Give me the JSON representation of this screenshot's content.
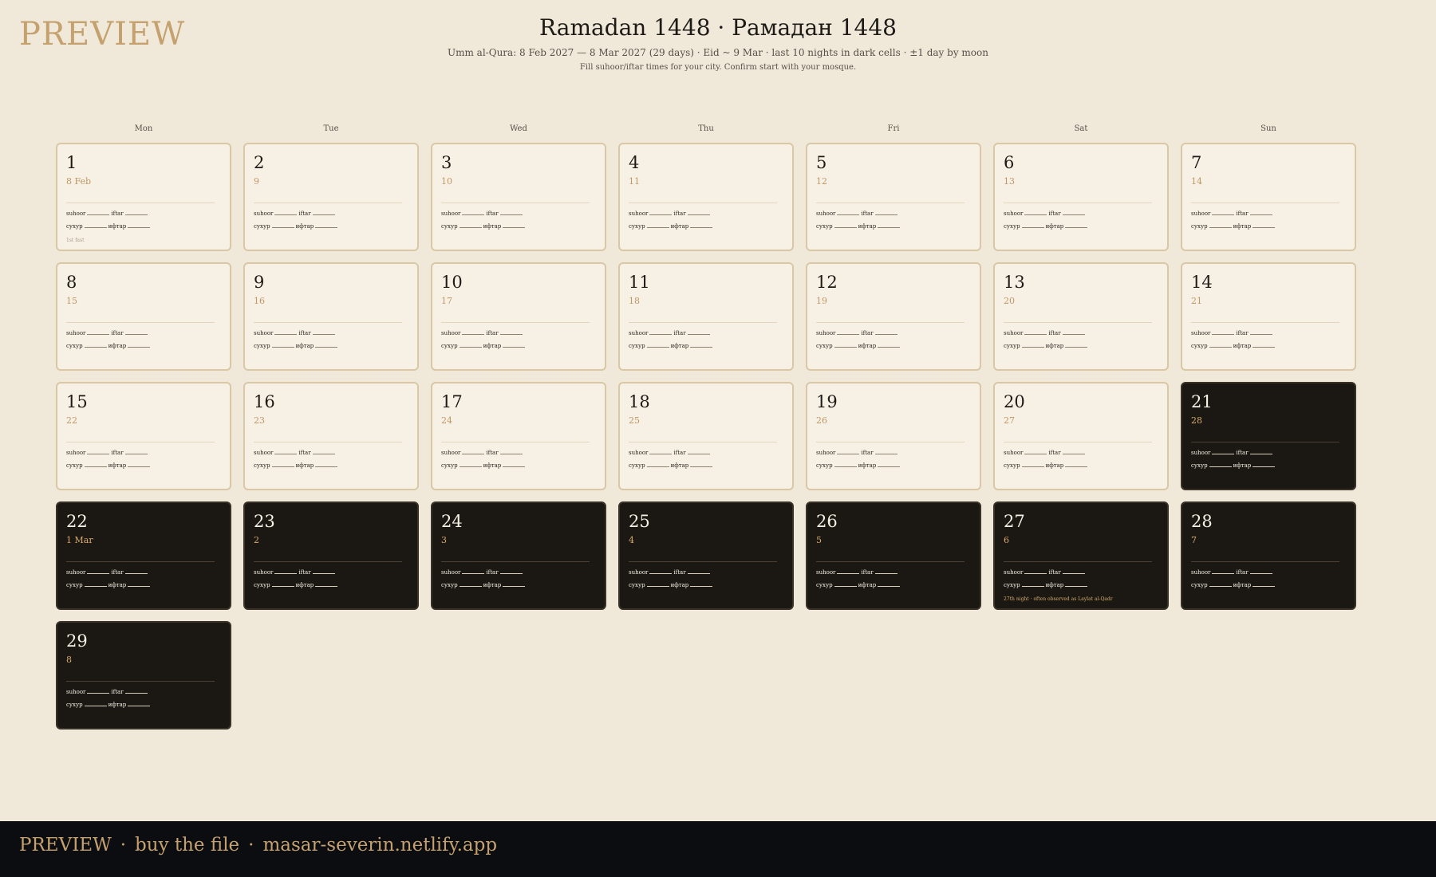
{
  "watermark": "PREVIEW",
  "header": {
    "title": "Ramadan 1448 · Рамадан 1448",
    "subtitle": "Umm al-Qura: 8 Feb 2027 — 8 Mar 2027 (29 days) · Eid ~ 9 Mar · last 10 nights in dark cells · ±1 day by moon",
    "note": "Fill suhoor/iftar times for your city. Confirm start with your mosque."
  },
  "weekdays": [
    "Mon",
    "Tue",
    "Wed",
    "Thu",
    "Fri",
    "Sat",
    "Sun"
  ],
  "labels": {
    "suhoor": "suhoor",
    "iftar": "iftar",
    "suhoor_ru": "сухур",
    "iftar_ru": "ифтар"
  },
  "days": [
    {
      "day": "1",
      "greg": "8 Feb",
      "dark": false,
      "note": "1st fast"
    },
    {
      "day": "2",
      "greg": "9",
      "dark": false
    },
    {
      "day": "3",
      "greg": "10",
      "dark": false
    },
    {
      "day": "4",
      "greg": "11",
      "dark": false
    },
    {
      "day": "5",
      "greg": "12",
      "dark": false
    },
    {
      "day": "6",
      "greg": "13",
      "dark": false
    },
    {
      "day": "7",
      "greg": "14",
      "dark": false
    },
    {
      "day": "8",
      "greg": "15",
      "dark": false
    },
    {
      "day": "9",
      "greg": "16",
      "dark": false
    },
    {
      "day": "10",
      "greg": "17",
      "dark": false
    },
    {
      "day": "11",
      "greg": "18",
      "dark": false
    },
    {
      "day": "12",
      "greg": "19",
      "dark": false
    },
    {
      "day": "13",
      "greg": "20",
      "dark": false
    },
    {
      "day": "14",
      "greg": "21",
      "dark": false
    },
    {
      "day": "15",
      "greg": "22",
      "dark": false
    },
    {
      "day": "16",
      "greg": "23",
      "dark": false
    },
    {
      "day": "17",
      "greg": "24",
      "dark": false
    },
    {
      "day": "18",
      "greg": "25",
      "dark": false
    },
    {
      "day": "19",
      "greg": "26",
      "dark": false
    },
    {
      "day": "20",
      "greg": "27",
      "dark": false
    },
    {
      "day": "21",
      "greg": "28",
      "dark": true
    },
    {
      "day": "22",
      "greg": "1 Mar",
      "dark": true
    },
    {
      "day": "23",
      "greg": "2",
      "dark": true
    },
    {
      "day": "24",
      "greg": "3",
      "dark": true
    },
    {
      "day": "25",
      "greg": "4",
      "dark": true
    },
    {
      "day": "26",
      "greg": "5",
      "dark": true
    },
    {
      "day": "27",
      "greg": "6",
      "dark": true,
      "note": "27th night · often observed as Laylat al-Qadr"
    },
    {
      "day": "28",
      "greg": "7",
      "dark": true
    },
    {
      "day": "29",
      "greg": "8",
      "dark": true
    }
  ],
  "footer": {
    "preview": "PREVIEW",
    "separator": "·",
    "buy": "buy the file",
    "site": "masar-severin.netlify.app"
  }
}
